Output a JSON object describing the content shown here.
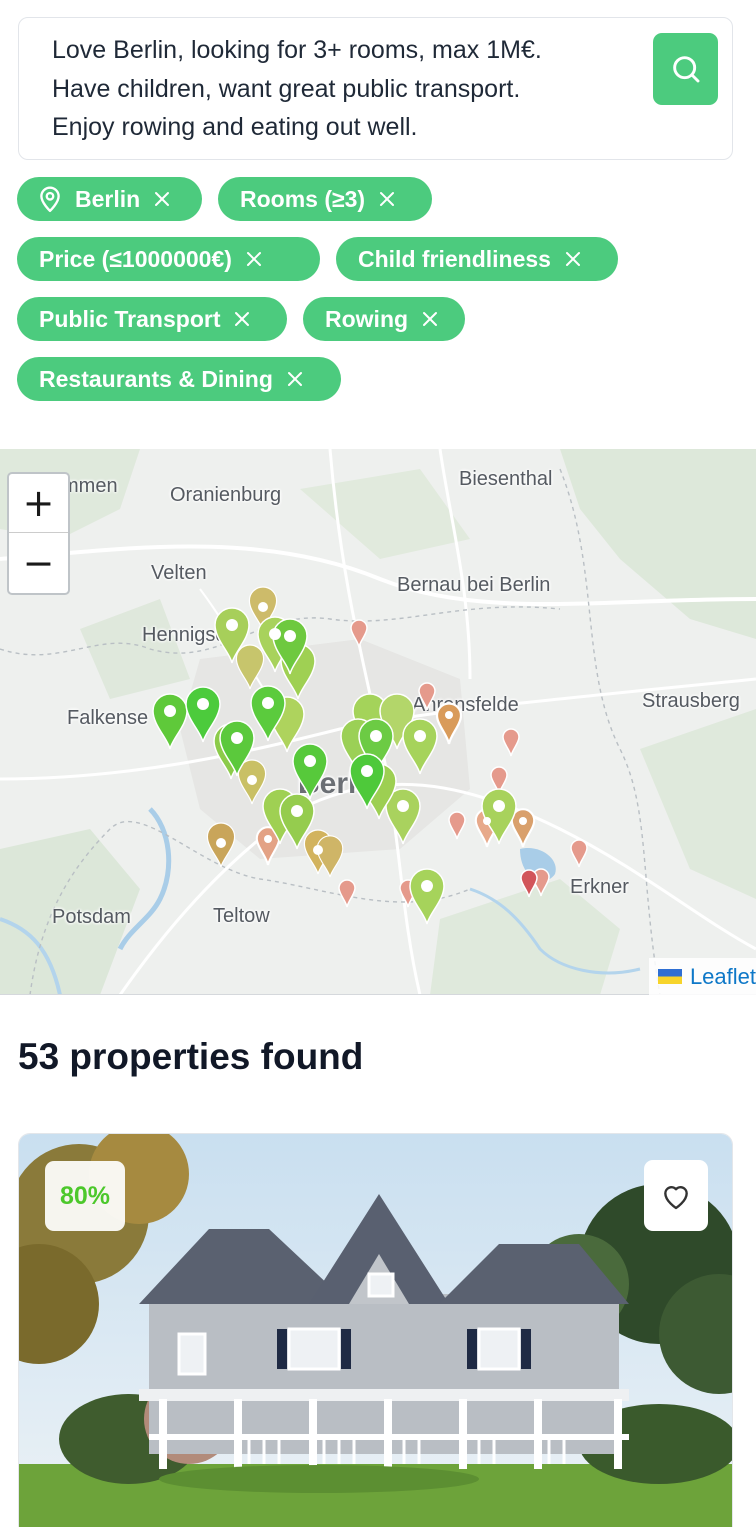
{
  "search": {
    "query": "Love Berlin, looking for 3+ rooms, max 1M€.\nHave children, want great public transport.\nEnjoy rowing and eating out well."
  },
  "icons": {
    "search_button": "search-icon",
    "location_chip": "map-pin-icon",
    "chip_remove": "close-icon",
    "favorite": "heart-icon"
  },
  "filters": [
    {
      "label": "Berlin",
      "icon": "map-pin-icon"
    },
    {
      "label": "Rooms (≥3)"
    },
    {
      "label": "Price (≤1000000€)"
    },
    {
      "label": "Child friendliness"
    },
    {
      "label": "Public Transport"
    },
    {
      "label": "Rowing"
    },
    {
      "label": "Restaurants & Dining"
    }
  ],
  "map": {
    "zoom_in": "+",
    "zoom_out": "−",
    "places": [
      "mmen",
      "Oranienburg",
      "Biesenthal",
      "Velten",
      "Bernau bei Berlin",
      "Hennigsdor",
      "Falkense",
      "Ahrensfelde",
      "Strausberg",
      "Berlin",
      "Potsdam",
      "Teltow",
      "Erkner"
    ],
    "attribution": "Leaflet"
  },
  "results": {
    "title": "53 properties found"
  },
  "property_card": {
    "match_score": "80%"
  },
  "colors": {
    "accent": "#4ccb7e",
    "score_text": "#4cc82b",
    "link": "#0e78c8"
  }
}
